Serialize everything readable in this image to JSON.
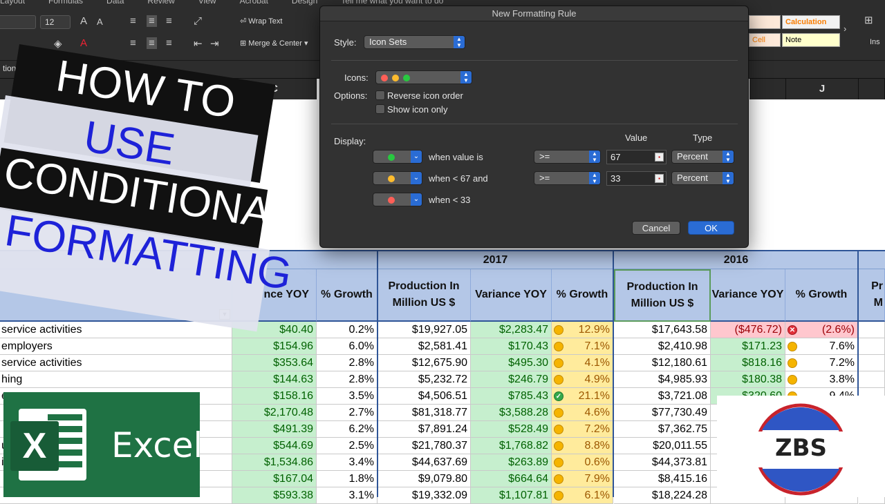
{
  "ribbon": {
    "menu_items": [
      "Layout",
      "Formulas",
      "Data",
      "Review",
      "View",
      "Acrobat",
      "Design",
      "Tell me what you want to do"
    ],
    "font_size": "12",
    "wrap_text": "Wrap Text",
    "merge_center": "Merge & Center",
    "styles": [
      {
        "label": "Calculation",
        "color": "#fa7d00"
      },
      {
        "label": "Note",
        "color": "#000000"
      },
      {
        "label": "Cell",
        "color": "#fa7d00"
      }
    ],
    "insert_label": "Ins"
  },
  "namebox": "tion In",
  "columns": [
    "C",
    "J"
  ],
  "title_lines": [
    "HOW TO",
    "USE",
    "CONDITIONAL",
    "FORMATTING"
  ],
  "dialog": {
    "title": "New Formatting Rule",
    "style_label": "Style:",
    "style_value": "Icon Sets",
    "icons_label": "Icons:",
    "options_label": "Options:",
    "reverse_label": "Reverse icon order",
    "show_icon_only_label": "Show icon only",
    "display_label": "Display:",
    "value_header": "Value",
    "type_header": "Type",
    "rules": [
      {
        "icon_color": "#28c840",
        "condition": "when value is",
        "operator": ">=",
        "value": "67",
        "type": "Percent"
      },
      {
        "icon_color": "#febc2e",
        "condition": "when < 67 and",
        "operator": ">=",
        "value": "33",
        "type": "Percent"
      },
      {
        "icon_color": "#ff5f57",
        "condition": "when < 33"
      }
    ],
    "cancel": "Cancel",
    "ok": "OK"
  },
  "table": {
    "year_2017": "2017",
    "year_2016": "2016",
    "headers": {
      "variance_partial": "nce YOY",
      "growth": "% Growth",
      "production_l1": "Production In",
      "production_l2": "Million US $",
      "variance": "Variance YOY",
      "pr_partial1": "Pr",
      "pr_partial2": "M"
    },
    "rows": [
      {
        "label": "service activities",
        "var18": "$40.40",
        "gr18": "0.2%",
        "prod17": "$19,927.05",
        "var17": "$2,283.47",
        "gr17": "12.9%",
        "ic17": "y",
        "prod16": "$17,643.58",
        "var16": "($476.72)",
        "gr16": "(2.6%)",
        "ic16": "r",
        "v16cls": "red"
      },
      {
        "label": "employers",
        "var18": "$154.96",
        "gr18": "6.0%",
        "prod17": "$2,581.41",
        "var17": "$170.43",
        "gr17": "7.1%",
        "ic17": "y",
        "prod16": "$2,410.98",
        "var16": "$171.23",
        "gr16": "7.6%",
        "ic16": "y",
        "v16cls": "green"
      },
      {
        "label": " service activities",
        "var18": "$353.64",
        "gr18": "2.8%",
        "prod17": "$12,675.90",
        "var17": "$495.30",
        "gr17": "4.1%",
        "ic17": "y",
        "prod16": "$12,180.61",
        "var16": "$818.16",
        "gr16": "7.2%",
        "ic16": "y",
        "v16cls": "green"
      },
      {
        "label": "hing",
        "var18": "$144.63",
        "gr18": "2.8%",
        "prod17": "$5,232.72",
        "var17": "$246.79",
        "gr17": "4.9%",
        "ic17": "y",
        "prod16": "$4,985.93",
        "var16": "$180.38",
        "gr16": "3.8%",
        "ic16": "y",
        "v16cls": "green"
      },
      {
        "label": "e",
        "var18": "$158.16",
        "gr18": "3.5%",
        "prod17": "$4,506.51",
        "var17": "$785.43",
        "gr17": "21.1%",
        "ic17": "g",
        "prod16": "$3,721.08",
        "var16": "$320.60",
        "gr16": "9.4%",
        "ic16": "y",
        "v16cls": "green"
      },
      {
        "label": "",
        "var18": "$2,170.48",
        "gr18": "2.7%",
        "prod17": "$81,318.77",
        "var17": "$3,588.28",
        "gr17": "4.6%",
        "ic17": "y",
        "prod16": "$77,730.49",
        "var16": "",
        "gr16": "",
        "ic16": "",
        "v16cls": ""
      },
      {
        "label": "",
        "var18": "$491.39",
        "gr18": "6.2%",
        "prod17": "$7,891.24",
        "var17": "$528.49",
        "gr17": "7.2%",
        "ic17": "y",
        "prod16": "$7,362.75",
        "var16": "",
        "gr16": "",
        "ic16": "",
        "v16cls": ""
      },
      {
        "label": "u",
        "var18": "$544.69",
        "gr18": "2.5%",
        "prod17": "$21,780.37",
        "var17": "$1,768.82",
        "gr17": "8.8%",
        "ic17": "y",
        "prod16": "$20,011.55",
        "var16": "",
        "gr16": "",
        "ic16": "",
        "v16cls": ""
      },
      {
        "label": "i",
        "var18": "$1,534.86",
        "gr18": "3.4%",
        "prod17": "$44,637.69",
        "var17": "$263.89",
        "gr17": "0.6%",
        "ic17": "y",
        "prod16": "$44,373.81",
        "var16": "",
        "gr16": "",
        "ic16": "",
        "v16cls": ""
      },
      {
        "label": "",
        "var18": "$167.04",
        "gr18": "1.8%",
        "prod17": "$9,079.80",
        "var17": "$664.64",
        "gr17": "7.9%",
        "ic17": "y",
        "prod16": "$8,415.16",
        "var16": "",
        "gr16": "",
        "ic16": "",
        "v16cls": ""
      },
      {
        "label": "",
        "var18": "$593.38",
        "gr18": "3.1%",
        "prod17": "$19,332.09",
        "var17": "$1,107.81",
        "gr17": "6.1%",
        "ic17": "y",
        "prod16": "$18,224.28",
        "var16": "",
        "gr16": "",
        "ic16": "",
        "v16cls": ""
      }
    ]
  },
  "excel_logo": {
    "letter": "X",
    "word": "Excel",
    "color": "#1f7244"
  },
  "zbs_logo": {
    "text": "ZBS",
    "ring_color": "#c8232c",
    "fill_color": "#2f56c4"
  }
}
